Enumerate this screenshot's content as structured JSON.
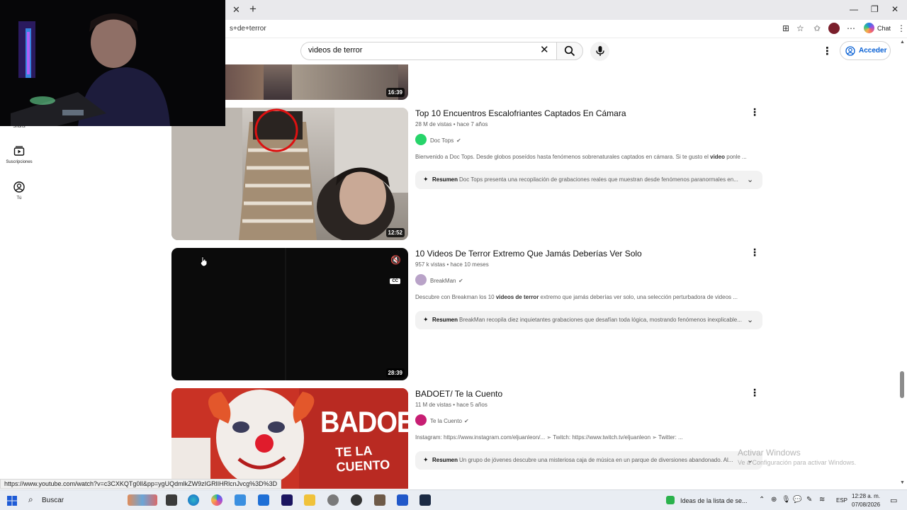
{
  "browser": {
    "url_visible": "s+de+terror",
    "chat_label": "Chat",
    "status_url": "https://www.youtube.com/watch?v=c3CXKQTg0lI&pp=ygUQdmlkZW9zIGRlIHRlcnJvcg%3D%3D"
  },
  "header": {
    "search_value": "videos de terror",
    "signin_label": "Acceder"
  },
  "sidebar": {
    "items": [
      {
        "label": "Shorts"
      },
      {
        "label": "Suscripciones"
      },
      {
        "label": "Tú"
      }
    ]
  },
  "results": {
    "top_partial": {
      "duration": "16:39"
    },
    "items": [
      {
        "title": "Top 10 Encuentros Escalofriantes Captados En Cámara",
        "meta": "28 M de vistas • hace 7 años",
        "channel": "Doc Tops",
        "desc_a": "Bienvenido a Doc Tops. Desde globos poseídos hasta fenómenos sobrenaturales captados en cámara. Si te gusto el ",
        "desc_b": "video",
        "desc_c": " ponle ...",
        "summary_label": "Resumen",
        "summary": "Doc Tops presenta una recopilación de grabaciones reales que muestran desde fenómenos paranormales en...",
        "duration": "12:52"
      },
      {
        "title": "10 Videos De Terror Extremo Que Jamás Deberías Ver Solo",
        "meta": "957 k vistas • hace 10 meses",
        "channel": "BreakMan",
        "desc_a": "Descubre con Breakman los 10 ",
        "desc_b": "videos de terror",
        "desc_c": " extremo que jamás deberías ver solo, una selección perturbadora de videos ...",
        "summary_label": "Resumen",
        "summary": "BreakMan recopila diez inquietantes grabaciones que desafían toda lógica, mostrando fenómenos inexplicable...",
        "duration": "28:39"
      },
      {
        "title": "BADOET/ Te la Cuento",
        "meta": "11 M de vistas • hace 5 años",
        "channel": "Te la Cuento",
        "desc_a": "Instagram: https://www.instagram.com/eljuanleon/... ➢ Twitch: https://www.twitch.tv/eljuanleon ➢ Twitter: ...",
        "desc_b": "",
        "desc_c": "",
        "summary_label": "Resumen",
        "summary": "Un grupo de jóvenes descubre una misteriosa caja de música en un parque de diversiones abandonado. Al...",
        "thumb_text_1": "BADOET",
        "thumb_text_2": "TE LA CUENTO"
      }
    ]
  },
  "watermark": {
    "line1": "Activar Windows",
    "line2": "Ve a Configuración para activar Windows."
  },
  "taskbar": {
    "search_label": "Buscar",
    "notification": "Ideas de la lista de se...",
    "lang": "ESP",
    "time": "12:28 a. m.",
    "date": "07/08/2026"
  }
}
